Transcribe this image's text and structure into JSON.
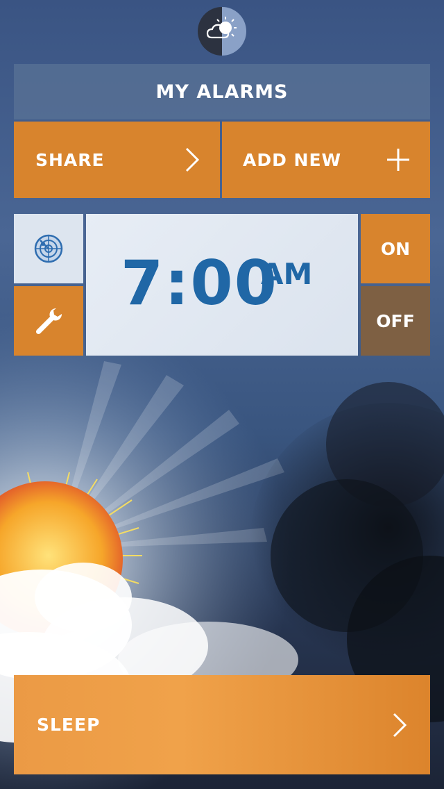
{
  "app": {
    "weather_icon": "partly-cloudy-icon"
  },
  "header": {
    "title": "MY ALARMS"
  },
  "actions": {
    "share_label": "SHARE",
    "share_icon": "chevron-right-icon",
    "add_label": "ADD NEW",
    "add_icon": "plus-icon"
  },
  "alarm": {
    "time": "7:00",
    "period": "AM",
    "on_label": "ON",
    "off_label": "OFF",
    "radar_icon": "radar-icon",
    "settings_icon": "wrench-icon"
  },
  "sleep": {
    "label": "SLEEP",
    "icon": "chevron-right-icon"
  },
  "colors": {
    "accent": "#d8842d",
    "off": "#7e6043",
    "clock_text": "#2067a6",
    "header_bg": "#5a7396"
  }
}
